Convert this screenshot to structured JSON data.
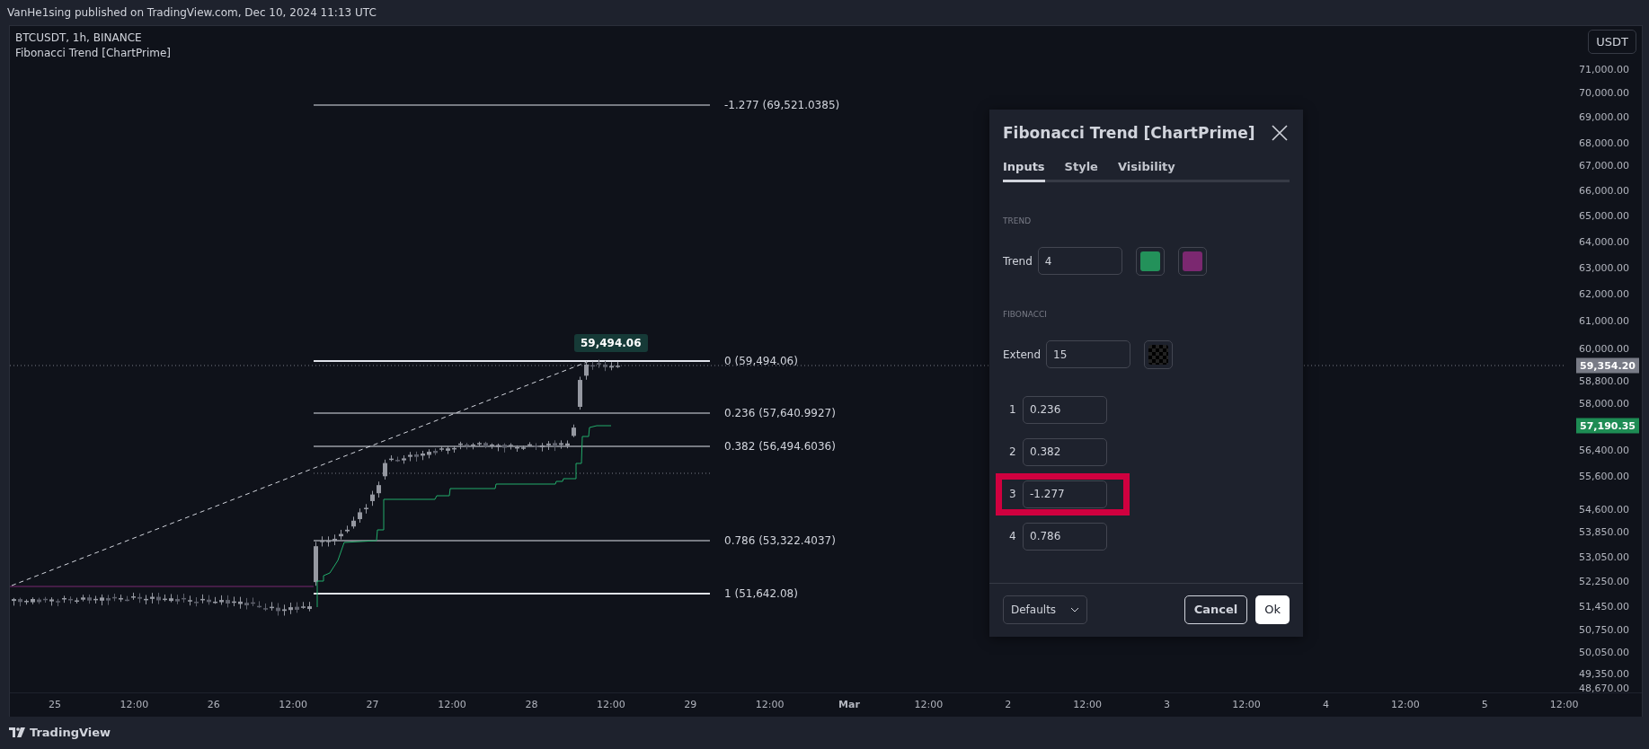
{
  "header": {
    "text": "VanHe1sing published on TradingView.com, Dec 10, 2024 11:13 UTC"
  },
  "legend": [
    "BTCUSDT, 1h, BINANCE",
    "Fibonacci Trend [ChartPrime]"
  ],
  "currency_button": "USDT",
  "price_axis": {
    "ticks": [
      "71,000.00",
      "70,000.00",
      "69,000.00",
      "68,000.00",
      "67,000.00",
      "66,000.00",
      "65,000.00",
      "64,000.00",
      "63,000.00",
      "62,000.00",
      "61,000.00",
      "60,000.00",
      "58,800.00",
      "58,000.00",
      "56,400.00",
      "55,600.00",
      "54,600.00",
      "53,850.00",
      "53,050.00",
      "52,250.00",
      "51,450.00",
      "50,750.00",
      "50,050.00",
      "49,350.00",
      "48,670.00"
    ],
    "tags": [
      {
        "text": "59,354.20",
        "color": "#787b86"
      },
      {
        "text": "57,190.35",
        "color": "#1e8c54"
      }
    ]
  },
  "time_axis": [
    {
      "label": "25",
      "bold": false
    },
    {
      "label": "12:00",
      "bold": false
    },
    {
      "label": "26",
      "bold": false
    },
    {
      "label": "12:00",
      "bold": false
    },
    {
      "label": "27",
      "bold": false
    },
    {
      "label": "12:00",
      "bold": false
    },
    {
      "label": "28",
      "bold": false
    },
    {
      "label": "12:00",
      "bold": false
    },
    {
      "label": "29",
      "bold": false
    },
    {
      "label": "12:00",
      "bold": false
    },
    {
      "label": "Mar",
      "bold": true
    },
    {
      "label": "12:00",
      "bold": false
    },
    {
      "label": "2",
      "bold": false
    },
    {
      "label": "12:00",
      "bold": false
    },
    {
      "label": "3",
      "bold": false
    },
    {
      "label": "12:00",
      "bold": false
    },
    {
      "label": "4",
      "bold": false
    },
    {
      "label": "12:00",
      "bold": false
    },
    {
      "label": "5",
      "bold": false
    },
    {
      "label": "12:00",
      "bold": false
    }
  ],
  "fib_levels": [
    {
      "label": "-1.277 (69,521.0385)"
    },
    {
      "label": "0 (59,494.06)"
    },
    {
      "label": "0.236 (57,640.9927)"
    },
    {
      "label": "0.382 (56,494.6036)"
    },
    {
      "label": "0.786 (53,322.4037)"
    },
    {
      "label": "1 (51,642.08)"
    }
  ],
  "peak_tag": "59,494.06",
  "dialog": {
    "title": "Fibonacci Trend [ChartPrime]",
    "tabs": [
      {
        "label": "Inputs",
        "selected": true
      },
      {
        "label": "Style",
        "selected": false
      },
      {
        "label": "Visibility",
        "selected": false
      }
    ],
    "sections": [
      {
        "heading": "TREND",
        "rows": [
          {
            "label": "Trend",
            "value": "4",
            "swatches": [
              {
                "kind": "solid",
                "color": "#23915a"
              },
              {
                "kind": "solid",
                "color": "#7b2870"
              }
            ]
          }
        ]
      },
      {
        "heading": "FIBONACCI",
        "rows": [
          {
            "label": "Extend",
            "value": "15",
            "swatches": [
              {
                "kind": "checker"
              }
            ]
          }
        ]
      }
    ],
    "levels": [
      {
        "label": "1",
        "value": "0.236",
        "highlighted": false
      },
      {
        "label": "2",
        "value": "0.382",
        "highlighted": false
      },
      {
        "label": "3",
        "value": "-1.277",
        "highlighted": true
      },
      {
        "label": "4",
        "value": "0.786",
        "highlighted": false
      }
    ],
    "defaults": "Defaults",
    "cancel": "Cancel",
    "ok": "Ok"
  },
  "footer": {
    "brand": "TradingView"
  }
}
